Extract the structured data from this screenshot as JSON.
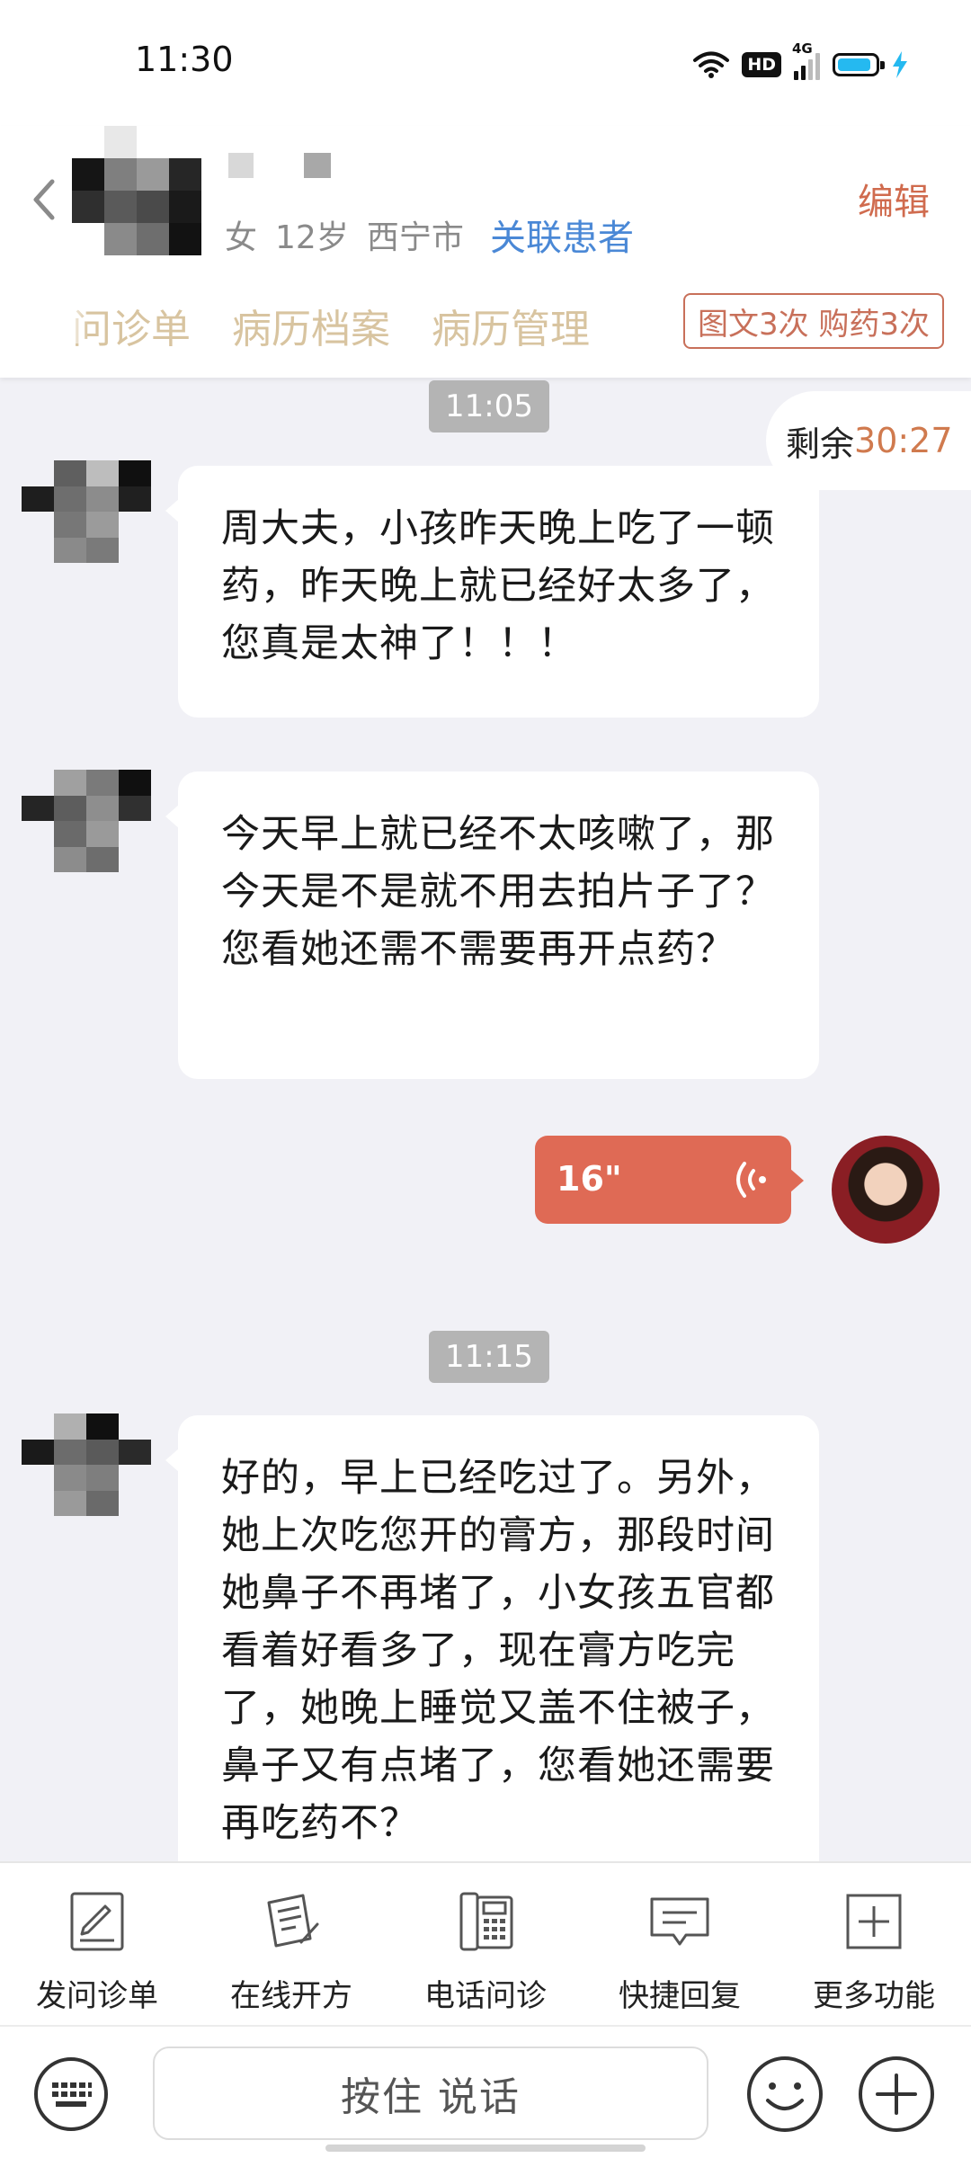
{
  "status_bar": {
    "time": "11:30",
    "hd_label": "HD",
    "network_label": "4G",
    "battery_percent": 90,
    "battery_color": "#25b9f0"
  },
  "patient": {
    "gender": "女",
    "age": "12岁",
    "city": "西宁市",
    "link_label": "关联患者",
    "edit_label": "编辑"
  },
  "tabs": [
    {
      "label": "问诊单"
    },
    {
      "label": "病历档案"
    },
    {
      "label": "病历管理"
    }
  ],
  "quota": "图文3次 购药3次",
  "remaining": {
    "label": "剩余",
    "count": "30:27"
  },
  "timestamps": [
    "11:05",
    "11:15"
  ],
  "messages": [
    {
      "text": "周大夫，小孩昨天晚上吃了一顿药，昨天晚上就已经好太多了，您真是太神了！！！"
    },
    {
      "text": "今天早上就已经不太咳嗽了，那今天是不是就不用去拍片子了？您看她还需不需要再开点药？"
    },
    {
      "voice_duration": "16\""
    },
    {
      "text": "好的，早上已经吃过了。另外，她上次吃您开的膏方，那段时间她鼻子不再堵了，小女孩五官都看着好看多了，现在膏方吃完了，她晚上睡觉又盖不住被子，鼻子又有点堵了，您看她还需要再吃药不？"
    }
  ],
  "functions": [
    {
      "label": "发问诊单",
      "icon": "questionnaire-icon"
    },
    {
      "label": "在线开方",
      "icon": "prescription-icon"
    },
    {
      "label": "电话问诊",
      "icon": "phone-icon"
    },
    {
      "label": "快捷回复",
      "icon": "quick-reply-icon"
    },
    {
      "label": "更多功能",
      "icon": "more-icon"
    }
  ],
  "input": {
    "hold_to_talk": "按住 说话"
  },
  "colors": {
    "accent": "#d06b4e",
    "link": "#4a88d6",
    "voice_bubble": "#df6a55",
    "tab_text": "#d8c4a0"
  }
}
